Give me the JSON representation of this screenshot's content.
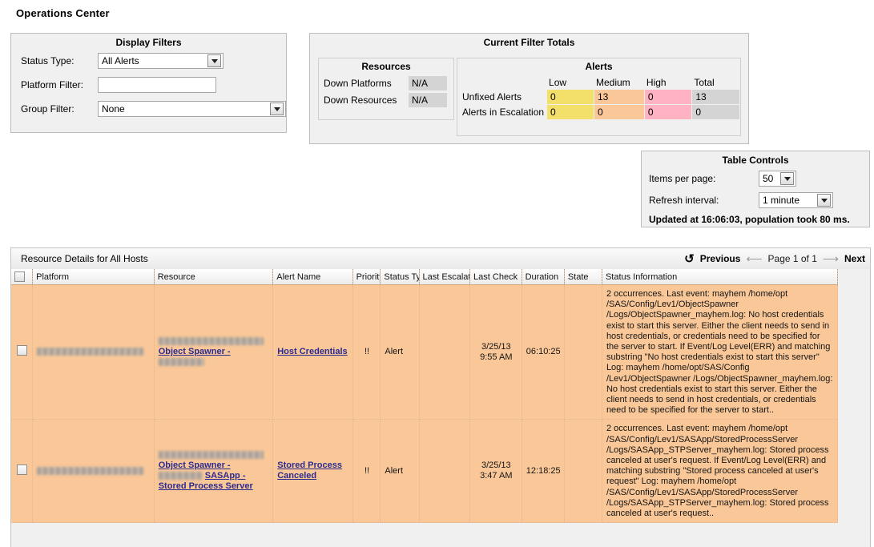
{
  "page": {
    "title": "Operations Center"
  },
  "display_filters": {
    "title": "Display Filters",
    "status_type_label": "Status Type:",
    "status_type_value": "All Alerts",
    "platform_filter_label": "Platform Filter:",
    "platform_filter_value": "",
    "platform_filter_placeholder": "",
    "group_filter_label": "Group Filter:",
    "group_filter_value": "None"
  },
  "filter_totals": {
    "title": "Current Filter Totals",
    "resources": {
      "title": "Resources",
      "rows": [
        {
          "label": "Down Platforms",
          "value": "N/A"
        },
        {
          "label": "Down Resources",
          "value": "N/A"
        }
      ]
    },
    "alerts": {
      "title": "Alerts",
      "columns": [
        "Low",
        "Medium",
        "High",
        "Total"
      ],
      "rows": [
        {
          "label": "Unfixed Alerts",
          "low": "0",
          "medium": "13",
          "high": "0",
          "total": "13"
        },
        {
          "label": "Alerts in Escalation",
          "low": "0",
          "medium": "0",
          "high": "0",
          "total": "0"
        }
      ]
    },
    "colors": {
      "low": "#f2e06a",
      "medium": "#fac898",
      "high": "#ffb2c1",
      "total": "#d4d4d4"
    }
  },
  "table_controls": {
    "title": "Table Controls",
    "items_per_page_label": "Items per page:",
    "items_per_page_value": "50",
    "refresh_interval_label": "Refresh interval:",
    "refresh_interval_value": "1 minute",
    "status": "Updated at 16:06:03, population took 80 ms."
  },
  "results": {
    "title": "Resource Details for All Hosts",
    "pager": {
      "refresh_icon": "refresh-icon",
      "previous": "Previous",
      "prev_arrow_icon": "arrow-left-icon",
      "page_text": "Page 1 of 1",
      "next_arrow_icon": "arrow-right-icon",
      "next": "Next"
    },
    "columns": [
      "",
      "Platform",
      "Resource",
      "Alert Name",
      "Priority",
      "Status Typ",
      "Last Escalat",
      "Last Check",
      "Duration",
      "State",
      "Status Information"
    ],
    "rows": [
      {
        "platform": "",
        "resource_prefix": "",
        "resource_link": "Object Spawner -",
        "resource_suffix": "",
        "alert_name": "Host Credentials",
        "priority": "!!",
        "status_type": "Alert",
        "last_escalation": "",
        "last_check": "3/25/13\n9:55 AM",
        "duration": "06:10:25",
        "state": "",
        "status_information": "2 occurrences. Last event: mayhem /home/opt /SAS/Config/Lev1/ObjectSpawner /Logs/ObjectSpawner_mayhem.log: No host credentials exist to start this server. Either the client needs to send in host credentials, or credentials need to be specified for the server to start. If Event/Log Level(ERR) and matching substring \"No host credentials exist to start this server\" Log: mayhem /home/opt/SAS/Config /Lev1/ObjectSpawner /Logs/ObjectSpawner_mayhem.log: No host credentials exist to start this server. Either the client needs to send in host credentials, or credentials need to be specified for the server to start.."
      },
      {
        "platform": "",
        "resource_prefix": "",
        "resource_link": "Object Spawner -",
        "resource_suffix": "SASApp - Stored Process Server",
        "alert_name": "Stored Process Canceled",
        "priority": "!!",
        "status_type": "Alert",
        "last_escalation": "",
        "last_check": "3/25/13\n3:47 AM",
        "duration": "12:18:25",
        "state": "",
        "status_information": "2 occurrences. Last event: mayhem /home/opt /SAS/Config/Lev1/SASApp/StoredProcessServer /Logs/SASApp_STPServer_mayhem.log: Stored process canceled at user's request. If Event/Log Level(ERR) and matching substring \"Stored process canceled at user's request\" Log: mayhem /home/opt /SAS/Config/Lev1/SASApp/StoredProcessServer /Logs/SASApp_STPServer_mayhem.log: Stored process canceled at user's request.."
      }
    ]
  }
}
